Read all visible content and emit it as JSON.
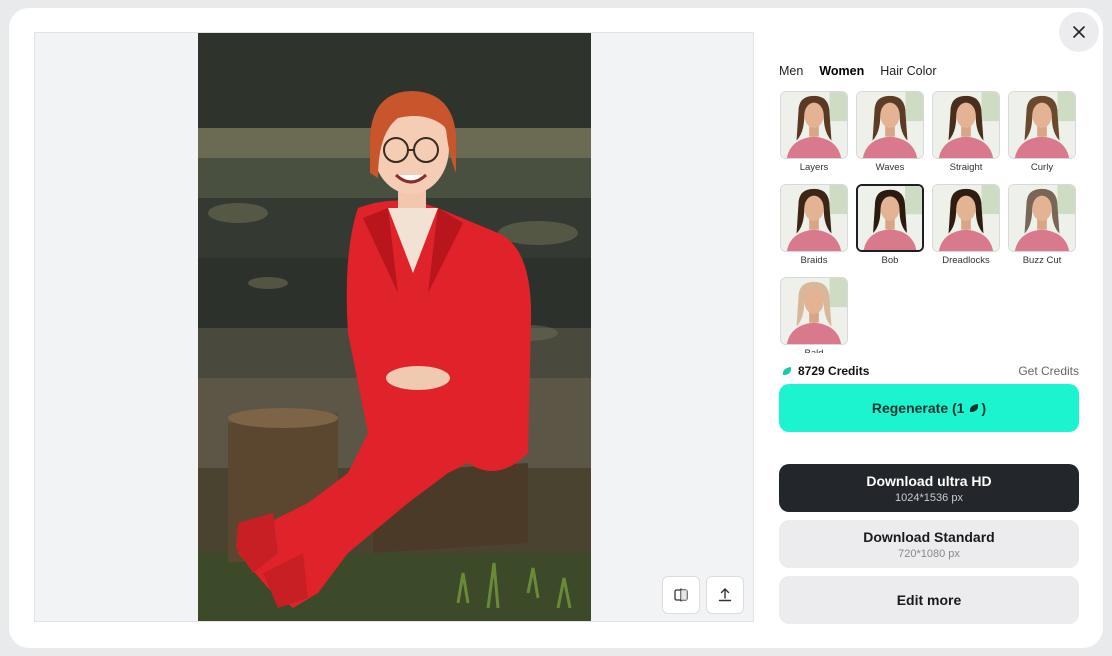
{
  "tabs": [
    {
      "label": "Men",
      "active": false
    },
    {
      "label": "Women",
      "active": true
    },
    {
      "label": "Hair Color",
      "active": false
    }
  ],
  "styles": [
    {
      "label": "Layers",
      "selected": false,
      "hair": "#5a3a22"
    },
    {
      "label": "Waves",
      "selected": false,
      "hair": "#5b3c24"
    },
    {
      "label": "Straight",
      "selected": false,
      "hair": "#4a2e1c"
    },
    {
      "label": "Curly",
      "selected": false,
      "hair": "#6a4a2c"
    },
    {
      "label": "Braids",
      "selected": false,
      "hair": "#3e2616"
    },
    {
      "label": "Bob",
      "selected": true,
      "hair": "#2a1a10"
    },
    {
      "label": "Dreadlocks",
      "selected": false,
      "hair": "#2f1d12"
    },
    {
      "label": "Buzz Cut",
      "selected": false,
      "hair": "#7a6656"
    },
    {
      "label": "Bald",
      "selected": false,
      "hair": "#d9b79a"
    }
  ],
  "credits": {
    "amount_label": "8729 Credits",
    "get_credits": "Get Credits"
  },
  "buttons": {
    "regenerate": "Regenerate (1",
    "regenerate_suffix": ")",
    "download_hd": {
      "title": "Download ultra HD",
      "sub": "1024*1536 px"
    },
    "download_standard": {
      "title": "Download Standard",
      "sub": "720*1080 px"
    },
    "edit_more": "Edit more"
  },
  "colors": {
    "accent": "#1cf4cf",
    "dark_button": "#23262b",
    "suit": "#e0232a",
    "hair": "#c8552c"
  },
  "icons": {
    "close": "close-icon",
    "compare": "compare-icon",
    "share": "upload-icon",
    "credit": "leaf-icon"
  }
}
